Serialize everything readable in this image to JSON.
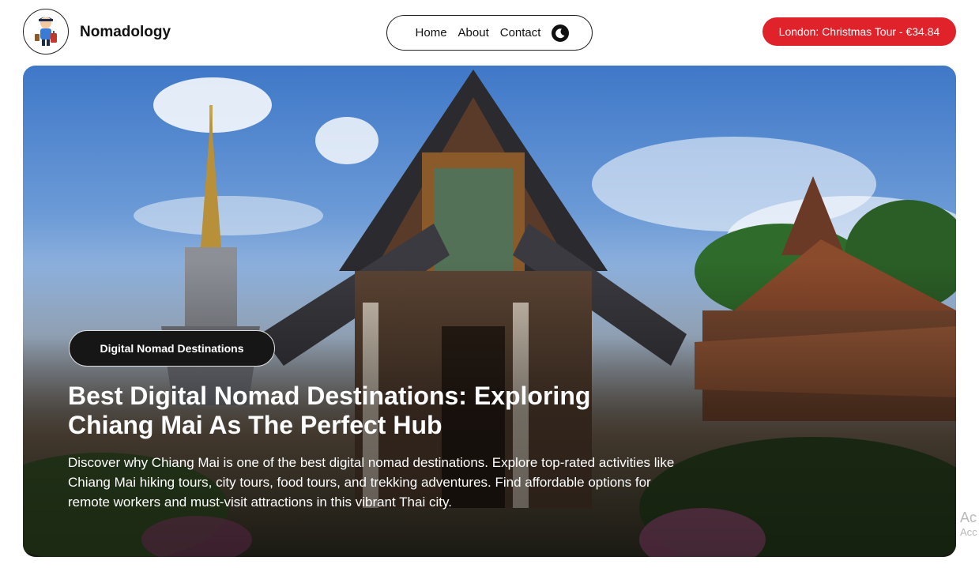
{
  "header": {
    "brand": "Nomadology",
    "logo_icon": "traveler-avatar-icon",
    "nav": {
      "items": [
        {
          "label": "Home"
        },
        {
          "label": "About"
        },
        {
          "label": "Contact"
        }
      ],
      "theme_toggle_icon": "dark-mode-toggle-icon"
    },
    "tour_pill": "London: Christmas Tour - €34.84"
  },
  "hero": {
    "tag": "Digital Nomad Destinations",
    "title": "Best Digital Nomad Destinations: Exploring Chiang Mai As The Perfect Hub",
    "description": "Discover why Chiang Mai is one of the best digital nomad destinations. Explore top-rated activities like Chiang Mai hiking tours, city tours, food tours, and trekking adventures. Find affordable options for remote workers and must-visit attractions in this vibrant Thai city."
  },
  "watermark": {
    "line1": "Ac",
    "line2": "Acc"
  },
  "colors": {
    "accent": "#e0232b",
    "tag_bg": "#161616"
  }
}
